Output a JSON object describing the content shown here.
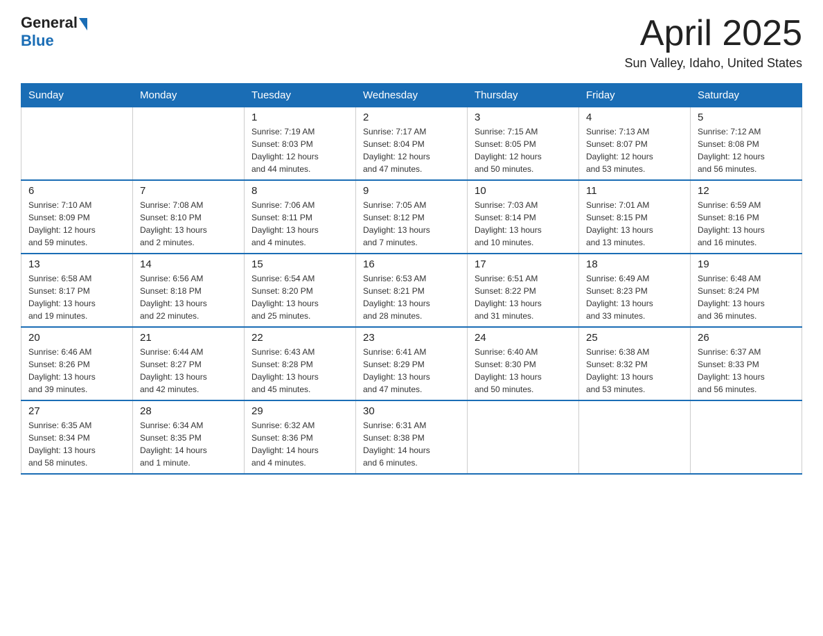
{
  "header": {
    "logo": {
      "general": "General",
      "blue": "Blue"
    },
    "title": "April 2025",
    "location": "Sun Valley, Idaho, United States"
  },
  "weekdays": [
    "Sunday",
    "Monday",
    "Tuesday",
    "Wednesday",
    "Thursday",
    "Friday",
    "Saturday"
  ],
  "weeks": [
    [
      {
        "day": "",
        "detail": ""
      },
      {
        "day": "",
        "detail": ""
      },
      {
        "day": "1",
        "detail": "Sunrise: 7:19 AM\nSunset: 8:03 PM\nDaylight: 12 hours\nand 44 minutes."
      },
      {
        "day": "2",
        "detail": "Sunrise: 7:17 AM\nSunset: 8:04 PM\nDaylight: 12 hours\nand 47 minutes."
      },
      {
        "day": "3",
        "detail": "Sunrise: 7:15 AM\nSunset: 8:05 PM\nDaylight: 12 hours\nand 50 minutes."
      },
      {
        "day": "4",
        "detail": "Sunrise: 7:13 AM\nSunset: 8:07 PM\nDaylight: 12 hours\nand 53 minutes."
      },
      {
        "day": "5",
        "detail": "Sunrise: 7:12 AM\nSunset: 8:08 PM\nDaylight: 12 hours\nand 56 minutes."
      }
    ],
    [
      {
        "day": "6",
        "detail": "Sunrise: 7:10 AM\nSunset: 8:09 PM\nDaylight: 12 hours\nand 59 minutes."
      },
      {
        "day": "7",
        "detail": "Sunrise: 7:08 AM\nSunset: 8:10 PM\nDaylight: 13 hours\nand 2 minutes."
      },
      {
        "day": "8",
        "detail": "Sunrise: 7:06 AM\nSunset: 8:11 PM\nDaylight: 13 hours\nand 4 minutes."
      },
      {
        "day": "9",
        "detail": "Sunrise: 7:05 AM\nSunset: 8:12 PM\nDaylight: 13 hours\nand 7 minutes."
      },
      {
        "day": "10",
        "detail": "Sunrise: 7:03 AM\nSunset: 8:14 PM\nDaylight: 13 hours\nand 10 minutes."
      },
      {
        "day": "11",
        "detail": "Sunrise: 7:01 AM\nSunset: 8:15 PM\nDaylight: 13 hours\nand 13 minutes."
      },
      {
        "day": "12",
        "detail": "Sunrise: 6:59 AM\nSunset: 8:16 PM\nDaylight: 13 hours\nand 16 minutes."
      }
    ],
    [
      {
        "day": "13",
        "detail": "Sunrise: 6:58 AM\nSunset: 8:17 PM\nDaylight: 13 hours\nand 19 minutes."
      },
      {
        "day": "14",
        "detail": "Sunrise: 6:56 AM\nSunset: 8:18 PM\nDaylight: 13 hours\nand 22 minutes."
      },
      {
        "day": "15",
        "detail": "Sunrise: 6:54 AM\nSunset: 8:20 PM\nDaylight: 13 hours\nand 25 minutes."
      },
      {
        "day": "16",
        "detail": "Sunrise: 6:53 AM\nSunset: 8:21 PM\nDaylight: 13 hours\nand 28 minutes."
      },
      {
        "day": "17",
        "detail": "Sunrise: 6:51 AM\nSunset: 8:22 PM\nDaylight: 13 hours\nand 31 minutes."
      },
      {
        "day": "18",
        "detail": "Sunrise: 6:49 AM\nSunset: 8:23 PM\nDaylight: 13 hours\nand 33 minutes."
      },
      {
        "day": "19",
        "detail": "Sunrise: 6:48 AM\nSunset: 8:24 PM\nDaylight: 13 hours\nand 36 minutes."
      }
    ],
    [
      {
        "day": "20",
        "detail": "Sunrise: 6:46 AM\nSunset: 8:26 PM\nDaylight: 13 hours\nand 39 minutes."
      },
      {
        "day": "21",
        "detail": "Sunrise: 6:44 AM\nSunset: 8:27 PM\nDaylight: 13 hours\nand 42 minutes."
      },
      {
        "day": "22",
        "detail": "Sunrise: 6:43 AM\nSunset: 8:28 PM\nDaylight: 13 hours\nand 45 minutes."
      },
      {
        "day": "23",
        "detail": "Sunrise: 6:41 AM\nSunset: 8:29 PM\nDaylight: 13 hours\nand 47 minutes."
      },
      {
        "day": "24",
        "detail": "Sunrise: 6:40 AM\nSunset: 8:30 PM\nDaylight: 13 hours\nand 50 minutes."
      },
      {
        "day": "25",
        "detail": "Sunrise: 6:38 AM\nSunset: 8:32 PM\nDaylight: 13 hours\nand 53 minutes."
      },
      {
        "day": "26",
        "detail": "Sunrise: 6:37 AM\nSunset: 8:33 PM\nDaylight: 13 hours\nand 56 minutes."
      }
    ],
    [
      {
        "day": "27",
        "detail": "Sunrise: 6:35 AM\nSunset: 8:34 PM\nDaylight: 13 hours\nand 58 minutes."
      },
      {
        "day": "28",
        "detail": "Sunrise: 6:34 AM\nSunset: 8:35 PM\nDaylight: 14 hours\nand 1 minute."
      },
      {
        "day": "29",
        "detail": "Sunrise: 6:32 AM\nSunset: 8:36 PM\nDaylight: 14 hours\nand 4 minutes."
      },
      {
        "day": "30",
        "detail": "Sunrise: 6:31 AM\nSunset: 8:38 PM\nDaylight: 14 hours\nand 6 minutes."
      },
      {
        "day": "",
        "detail": ""
      },
      {
        "day": "",
        "detail": ""
      },
      {
        "day": "",
        "detail": ""
      }
    ]
  ]
}
